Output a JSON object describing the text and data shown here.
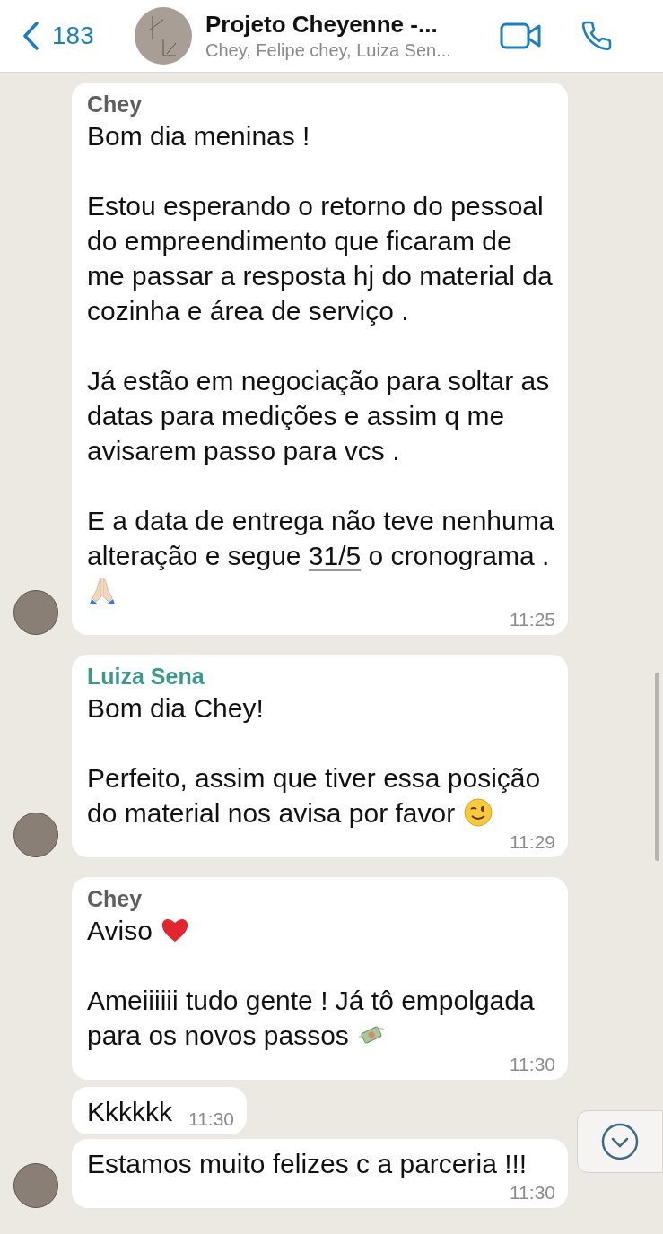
{
  "header": {
    "back_count": "183",
    "title": "Projeto Cheyenne -...",
    "subtitle": "Chey, Felipe chey, Luiza Sen..."
  },
  "messages": [
    {
      "sender": "Chey",
      "color": "#5e5e5e",
      "avatar": true,
      "time": "11:25",
      "paragraphs": [
        [
          {
            "kind": "text",
            "text": "Bom dia meninas !"
          }
        ],
        [
          {
            "kind": "text",
            "text": "Estou esperando o retorno do pessoal do empreendimento que ficaram de me passar a resposta hj do material da cozinha e área de serviço ."
          }
        ],
        [
          {
            "kind": "text",
            "text": "Já estão em negociação para soltar as datas para medições e assim q me avisarem passo para vcs ."
          }
        ],
        [
          {
            "kind": "text",
            "text": "E a data de entrega não teve nenhuma alteração e segue "
          },
          {
            "kind": "date",
            "text": "31/5"
          },
          {
            "kind": "text",
            "text": " o cronograma . "
          },
          {
            "kind": "pray"
          }
        ]
      ]
    },
    {
      "sender": "Luiza Sena",
      "color": "#3a9a8a",
      "avatar": true,
      "time": "11:29",
      "paragraphs": [
        [
          {
            "kind": "text",
            "text": "Bom dia Chey!"
          }
        ],
        [
          {
            "kind": "text",
            "text": "Perfeito, assim que tiver essa posição do material nos avisa por favor "
          },
          {
            "kind": "wink"
          }
        ]
      ]
    },
    {
      "sender": "Chey",
      "color": "#5e5e5e",
      "avatar": false,
      "time": "11:30",
      "paragraphs": [
        [
          {
            "kind": "text",
            "text": "Aviso "
          },
          {
            "kind": "heart"
          }
        ],
        [
          {
            "kind": "text",
            "text": "Ameiiiiii tudo gente ! Já tô empolgada para os novos passos "
          },
          {
            "kind": "money"
          }
        ]
      ]
    },
    {
      "avatar": false,
      "time": "11:30",
      "paragraphs": [
        [
          {
            "kind": "text",
            "text": "Kkkkkk"
          }
        ]
      ]
    },
    {
      "avatar": true,
      "time": "11:30",
      "paragraphs": [
        [
          {
            "kind": "text",
            "text": "Estamos muito felizes c a parceria !!!"
          }
        ]
      ]
    }
  ]
}
